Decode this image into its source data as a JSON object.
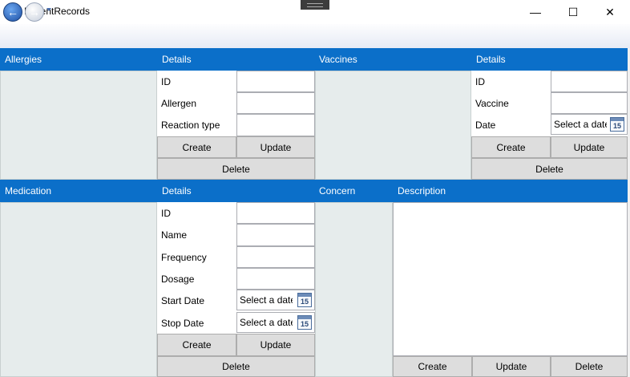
{
  "window": {
    "title": "PatientRecords",
    "minimize": "—",
    "maximize": "☐",
    "close": "✕"
  },
  "nav": {
    "back": "←",
    "forward": "→"
  },
  "allergies": {
    "header": "Allergies",
    "details_header": "Details",
    "fields": [
      "ID",
      "Allergen",
      "Reaction type"
    ],
    "create": "Create",
    "update": "Update",
    "delete": "Delete"
  },
  "vaccines": {
    "header": "Vaccines",
    "details_header": "Details",
    "fields": [
      "ID",
      "Vaccine",
      "Date"
    ],
    "date_placeholder": "Select a date",
    "calendar_day": "15",
    "create": "Create",
    "update": "Update",
    "delete": "Delete"
  },
  "medication": {
    "header": "Medication",
    "details_header": "Details",
    "fields": [
      "ID",
      "Name",
      "Frequency",
      "Dosage",
      "Start Date",
      "Stop Date"
    ],
    "date_placeholder": "Select a date",
    "calendar_day": "15",
    "create": "Create",
    "update": "Update",
    "delete": "Delete"
  },
  "concern": {
    "header": "Concern",
    "description_header": "Description",
    "create": "Create",
    "update": "Update",
    "delete": "Delete"
  }
}
